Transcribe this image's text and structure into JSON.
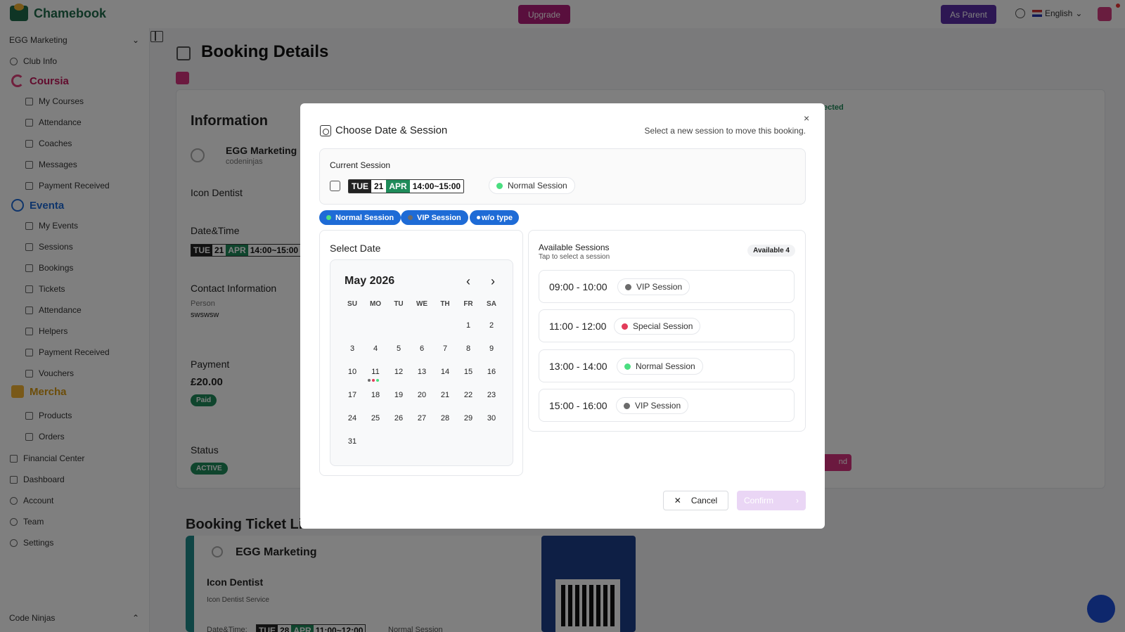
{
  "app": {
    "name": "Chamebook"
  },
  "topbar": {
    "upgrade_label": "Upgrade",
    "as_parent_label": "As Parent",
    "language": "English"
  },
  "sidebar": {
    "org_select": "EGG Marketing",
    "club_info": "Club Info",
    "coursia": {
      "title": "Coursia",
      "items": [
        "My Courses",
        "Attendance",
        "Coaches",
        "Messages",
        "Payment Received"
      ]
    },
    "eventa": {
      "title": "Eventa",
      "items": [
        "My Events",
        "Sessions",
        "Bookings",
        "Tickets",
        "Attendance",
        "Helpers",
        "Payment Received",
        "Vouchers"
      ]
    },
    "mercha": {
      "title": "Mercha",
      "items": [
        "Products",
        "Orders"
      ]
    },
    "bottom_items": [
      "Financial Center",
      "Dashboard",
      "Account",
      "Team",
      "Settings"
    ],
    "footer_org": "Code Ninjas"
  },
  "page": {
    "title": "Booking Details",
    "info_heading": "Information",
    "org_name": "EGG Marketing",
    "org_sub": "codeninjas",
    "service": "Icon Dentist",
    "datetime_label": "Date&Time",
    "datetime_chip": {
      "dow": "TUE",
      "day": "21",
      "month": "APR",
      "time": "14:00~15:00"
    },
    "contact_label": "Contact Information",
    "person_label": "Person",
    "person_value": "swswsw",
    "payment_label": "Payment",
    "payment_amount": "£20.00",
    "payment_status": "Paid",
    "status_label": "Status",
    "status_value": "ACTIVE",
    "right_partial_1": "ected",
    "right_partial_2": "nd",
    "ticket_list_heading": "Booking Ticket Li",
    "ticket": {
      "org": "EGG Marketing",
      "service": "Icon Dentist",
      "service_sub": "Icon Dentist Service",
      "datetime_label": "Date&Time:",
      "chip": {
        "dow": "TUE",
        "day": "28",
        "month": "APR",
        "time": "11:00~12:00"
      },
      "session": "Normal Session"
    }
  },
  "modal": {
    "title": "Choose Date & Session",
    "hint": "Select a new session to move this booking.",
    "close_glyph": "×",
    "current_label": "Current Session",
    "current_chip": {
      "dow": "TUE",
      "day": "21",
      "month": "APR",
      "time": "14:00~15:00"
    },
    "current_session": "Normal Session",
    "filters": [
      {
        "label": "Normal Session",
        "color": "#4ade80"
      },
      {
        "label": "VIP Session",
        "color": "#6b6b6b"
      },
      {
        "label": "w/o type",
        "color": "#ffffff"
      }
    ],
    "select_date_title": "Select Date",
    "calendar": {
      "month_label": "May 2026",
      "weekday_headers": [
        "SU",
        "MO",
        "TU",
        "WE",
        "TH",
        "FR",
        "SA"
      ],
      "weeks": [
        [
          "",
          "",
          "",
          "",
          "",
          "1",
          "2"
        ],
        [
          "3",
          "4",
          "5",
          "6",
          "7",
          "8",
          "9"
        ],
        [
          "10",
          "11",
          "12",
          "13",
          "14",
          "15",
          "16"
        ],
        [
          "17",
          "18",
          "19",
          "20",
          "21",
          "22",
          "23"
        ],
        [
          "24",
          "25",
          "26",
          "27",
          "28",
          "29",
          "30"
        ],
        [
          "31",
          "",
          "",
          "",
          "",
          "",
          ""
        ]
      ],
      "marked_day": "11",
      "marked_day_dot_colors": [
        "#6b6b6b",
        "#e23c5a",
        "#4ade80"
      ]
    },
    "available": {
      "title": "Available Sessions",
      "subtitle": "Tap to select a session",
      "badge": "Available 4",
      "slots": [
        {
          "time": "09:00 - 10:00",
          "session": "VIP Session",
          "color": "#6b6b6b"
        },
        {
          "time": "11:00 - 12:00",
          "session": "Special Session",
          "color": "#e23c5a"
        },
        {
          "time": "13:00 - 14:00",
          "session": "Normal Session",
          "color": "#4ade80"
        },
        {
          "time": "15:00 - 16:00",
          "session": "VIP Session",
          "color": "#6b6b6b"
        }
      ]
    },
    "cancel_label": "Cancel",
    "confirm_label": "Confirm"
  },
  "colors": {
    "normal": "#4ade80",
    "vip": "#6b6b6b",
    "special": "#e23c5a",
    "filter_bg": "#1e6bd6",
    "brand": "#1f6b4a"
  },
  "icons": [
    "calendar-clock-icon",
    "close-icon",
    "chevron-left-icon",
    "chevron-right-icon",
    "globe-icon"
  ]
}
